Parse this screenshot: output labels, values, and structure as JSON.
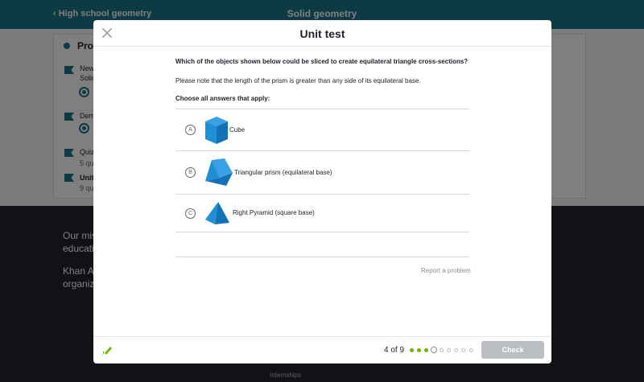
{
  "background": {
    "header": {
      "back_label": "High school geometry",
      "title": "Solid geometry"
    },
    "card": {
      "heading": "Prop",
      "items": [
        {
          "title": "New",
          "subtitle": "Solid"
        },
        {
          "title": "Dem"
        },
        {
          "title": "Quiz",
          "subtitle": "5 qu"
        },
        {
          "title": "Unit",
          "subtitle": "9 qu"
        }
      ]
    },
    "footer": {
      "lines": [
        "Our mis",
        "educati",
        "Khan Ac",
        "organiz"
      ],
      "link": "Internships"
    }
  },
  "modal": {
    "title": "Unit test",
    "question": "Which of the objects shown below could be sliced to create equilateral triangle cross-sections?",
    "note": "Please note that the length of the prism is greater than any side of its equilateral base.",
    "instruction": "Choose all answers that apply:",
    "choices": [
      {
        "letter": "A",
        "label": "Cube"
      },
      {
        "letter": "B",
        "label": "Triangular prism (equilateral base)"
      },
      {
        "letter": "C",
        "label": "Right Pyramid (square base)"
      }
    ],
    "report_label": "Report a problem",
    "footer": {
      "progress_text": "4 of 9",
      "total_questions": 9,
      "completed": 3,
      "current": 4,
      "check_label": "Check"
    }
  },
  "colors": {
    "header_teal": "#1c758a",
    "progress_green": "#71b307",
    "shape_blue": "#1f8fd6",
    "check_disabled": "#babec2"
  },
  "icons": {
    "close": "close-icon",
    "scratchpad": "scratchpad-pencil-icon"
  }
}
